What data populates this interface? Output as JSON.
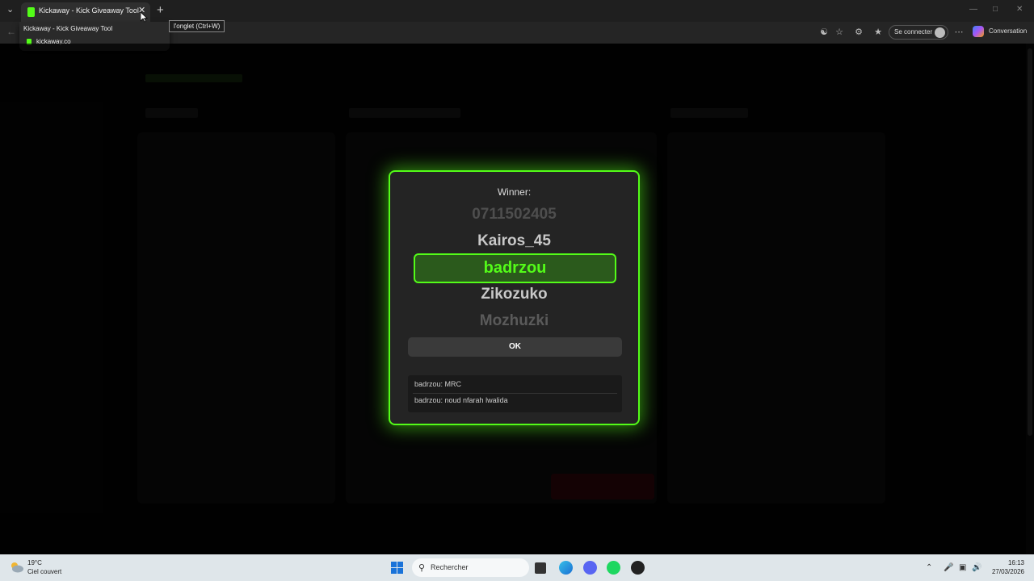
{
  "browser": {
    "tab_title": "Kickaway - Kick Giveaway Tool",
    "close_tooltip": "Fermer l'onglet (Ctrl+W)",
    "tooltip_visible_text": "l'onglet (Ctrl+W)",
    "hover_card": {
      "title": "Kickaway - Kick Giveaway Tool",
      "url": "kickaway.co"
    },
    "sign_in_label": "Se connecter",
    "copilot_label": "Conversation"
  },
  "modal": {
    "label": "Winner:",
    "reel": [
      "0711502405",
      "Kairos_45",
      "badrzou",
      "Zikozuko",
      "Mozhuzki"
    ],
    "winner": "badrzou",
    "ok_label": "OK",
    "chat_messages": [
      "badrzou: MRC",
      "badrzou: noud nfarah lwalida"
    ]
  },
  "colors": {
    "accent": "#53fc18"
  },
  "taskbar": {
    "weather_temp": "19°C",
    "weather_desc": "Ciel couvert",
    "search_placeholder": "Rechercher",
    "time": "16:13",
    "date": "27/03/2026"
  }
}
